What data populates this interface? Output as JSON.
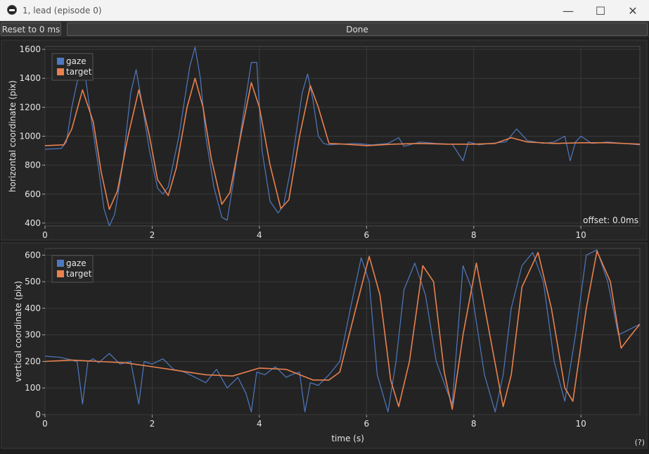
{
  "window": {
    "title": "1, lead (episode 0)",
    "icon": "app-logo-icon",
    "controls": [
      "minimize-icon",
      "maximize-icon",
      "close-icon"
    ]
  },
  "toolbar": {
    "reset_label": "Reset to 0 ms",
    "done_label": "Done"
  },
  "help_label": "(?)",
  "colors": {
    "background": "#1e1e1e",
    "plot_bg": "#232323",
    "gaze": "#4e79c0",
    "target": "#e9814e",
    "grid": "#3a3a3a"
  },
  "chart_data": [
    {
      "type": "line",
      "ylabel": "horizontal coordinate (pix)",
      "xlabel": "",
      "xlim": [
        0,
        11.1
      ],
      "ylim": [
        380,
        1620
      ],
      "xticks": [
        0,
        2,
        4,
        6,
        8,
        10
      ],
      "yticks": [
        400,
        600,
        800,
        1000,
        1200,
        1400,
        1600
      ],
      "grid": true,
      "legend": "top-left",
      "annotation": "offset: 0.0ms",
      "series": [
        {
          "name": "gaze",
          "color": "#4e79c0",
          "x": [
            0,
            0.3,
            0.4,
            0.5,
            0.65,
            0.75,
            0.85,
            1.0,
            1.1,
            1.2,
            1.3,
            1.45,
            1.6,
            1.7,
            1.8,
            1.95,
            2.1,
            2.2,
            2.3,
            2.5,
            2.7,
            2.8,
            2.9,
            3.0,
            3.15,
            3.3,
            3.4,
            3.5,
            3.7,
            3.85,
            3.95,
            4.05,
            4.2,
            4.35,
            4.45,
            4.6,
            4.8,
            4.9,
            5.0,
            5.1,
            5.2,
            5.3,
            5.5,
            5.8,
            6.1,
            6.4,
            6.6,
            6.7,
            6.8,
            7.0,
            7.3,
            7.6,
            7.8,
            7.9,
            8.1,
            8.3,
            8.6,
            8.8,
            9.0,
            9.3,
            9.5,
            9.7,
            9.8,
            9.9,
            10.0,
            10.2,
            10.5,
            10.8,
            11.1
          ],
          "y": [
            910,
            915,
            960,
            1200,
            1460,
            1420,
            1150,
            780,
            500,
            380,
            460,
            800,
            1300,
            1460,
            1250,
            900,
            640,
            600,
            650,
            1000,
            1480,
            1615,
            1400,
            1000,
            650,
            440,
            420,
            650,
            1150,
            1510,
            1510,
            900,
            550,
            470,
            520,
            800,
            1300,
            1430,
            1250,
            1000,
            950,
            940,
            945,
            950,
            940,
            950,
            990,
            930,
            940,
            960,
            950,
            945,
            830,
            960,
            940,
            950,
            960,
            1050,
            970,
            950,
            960,
            1000,
            830,
            960,
            1000,
            950,
            960,
            950,
            940
          ]
        },
        {
          "name": "target",
          "color": "#e9814e",
          "x": [
            0,
            0.35,
            0.5,
            0.7,
            0.9,
            1.05,
            1.2,
            1.35,
            1.55,
            1.75,
            1.95,
            2.1,
            2.3,
            2.45,
            2.65,
            2.8,
            2.95,
            3.1,
            3.3,
            3.45,
            3.65,
            3.85,
            4.0,
            4.2,
            4.4,
            4.55,
            4.75,
            4.95,
            5.1,
            5.3,
            5.6,
            6.0,
            6.5,
            7.0,
            7.5,
            8.0,
            8.4,
            8.7,
            9.0,
            9.5,
            10.0,
            10.5,
            11.1
          ],
          "y": [
            935,
            940,
            1050,
            1320,
            1100,
            750,
            495,
            620,
            1000,
            1320,
            1000,
            700,
            590,
            780,
            1200,
            1400,
            1200,
            850,
            530,
            610,
            1000,
            1370,
            1200,
            800,
            500,
            560,
            1000,
            1350,
            1200,
            950,
            945,
            935,
            945,
            950,
            945,
            945,
            950,
            990,
            960,
            950,
            955,
            955,
            945
          ]
        }
      ]
    },
    {
      "type": "line",
      "ylabel": "vertical coordinate (pix)",
      "xlabel": "time (s)",
      "xlim": [
        0,
        11.1
      ],
      "ylim": [
        0,
        625
      ],
      "xticks": [
        0,
        2,
        4,
        6,
        8,
        10
      ],
      "yticks": [
        0,
        100,
        200,
        300,
        400,
        500,
        600
      ],
      "grid": true,
      "legend": "top-left",
      "series": [
        {
          "name": "gaze",
          "color": "#4e79c0",
          "x": [
            0,
            0.3,
            0.6,
            0.7,
            0.8,
            0.9,
            1.0,
            1.2,
            1.4,
            1.6,
            1.75,
            1.85,
            2.0,
            2.2,
            2.4,
            2.6,
            2.8,
            3.0,
            3.2,
            3.4,
            3.6,
            3.75,
            3.85,
            3.95,
            4.1,
            4.3,
            4.5,
            4.6,
            4.75,
            4.85,
            4.95,
            5.1,
            5.3,
            5.5,
            5.7,
            5.9,
            6.05,
            6.2,
            6.4,
            6.55,
            6.7,
            6.9,
            7.1,
            7.3,
            7.5,
            7.6,
            7.7,
            7.8,
            7.95,
            8.2,
            8.4,
            8.55,
            8.7,
            8.9,
            9.1,
            9.3,
            9.5,
            9.7,
            9.9,
            10.1,
            10.3,
            10.5,
            10.7,
            10.9,
            11.1
          ],
          "y": [
            220,
            215,
            200,
            40,
            200,
            210,
            195,
            230,
            190,
            200,
            40,
            200,
            190,
            210,
            170,
            160,
            140,
            120,
            170,
            100,
            140,
            80,
            10,
            160,
            150,
            180,
            140,
            150,
            160,
            10,
            120,
            110,
            150,
            200,
            400,
            590,
            500,
            150,
            10,
            200,
            470,
            570,
            450,
            200,
            90,
            40,
            300,
            560,
            480,
            150,
            10,
            150,
            400,
            560,
            610,
            500,
            200,
            50,
            300,
            600,
            620,
            500,
            300,
            320,
            340
          ]
        },
        {
          "name": "target",
          "color": "#e9814e",
          "x": [
            0,
            0.5,
            1.0,
            1.5,
            2.0,
            2.5,
            3.0,
            3.5,
            4.0,
            4.5,
            5.0,
            5.3,
            5.5,
            5.8,
            6.05,
            6.25,
            6.45,
            6.6,
            6.8,
            7.05,
            7.25,
            7.45,
            7.6,
            7.8,
            8.05,
            8.3,
            8.55,
            8.7,
            8.9,
            9.2,
            9.45,
            9.7,
            9.85,
            10.1,
            10.3,
            10.55,
            10.75,
            10.9,
            11.1
          ],
          "y": [
            200,
            205,
            200,
            195,
            180,
            165,
            150,
            145,
            175,
            170,
            130,
            130,
            160,
            400,
            595,
            450,
            130,
            30,
            200,
            560,
            500,
            160,
            20,
            300,
            570,
            300,
            30,
            150,
            480,
            610,
            400,
            100,
            50,
            400,
            615,
            500,
            250,
            290,
            340
          ]
        }
      ]
    }
  ]
}
